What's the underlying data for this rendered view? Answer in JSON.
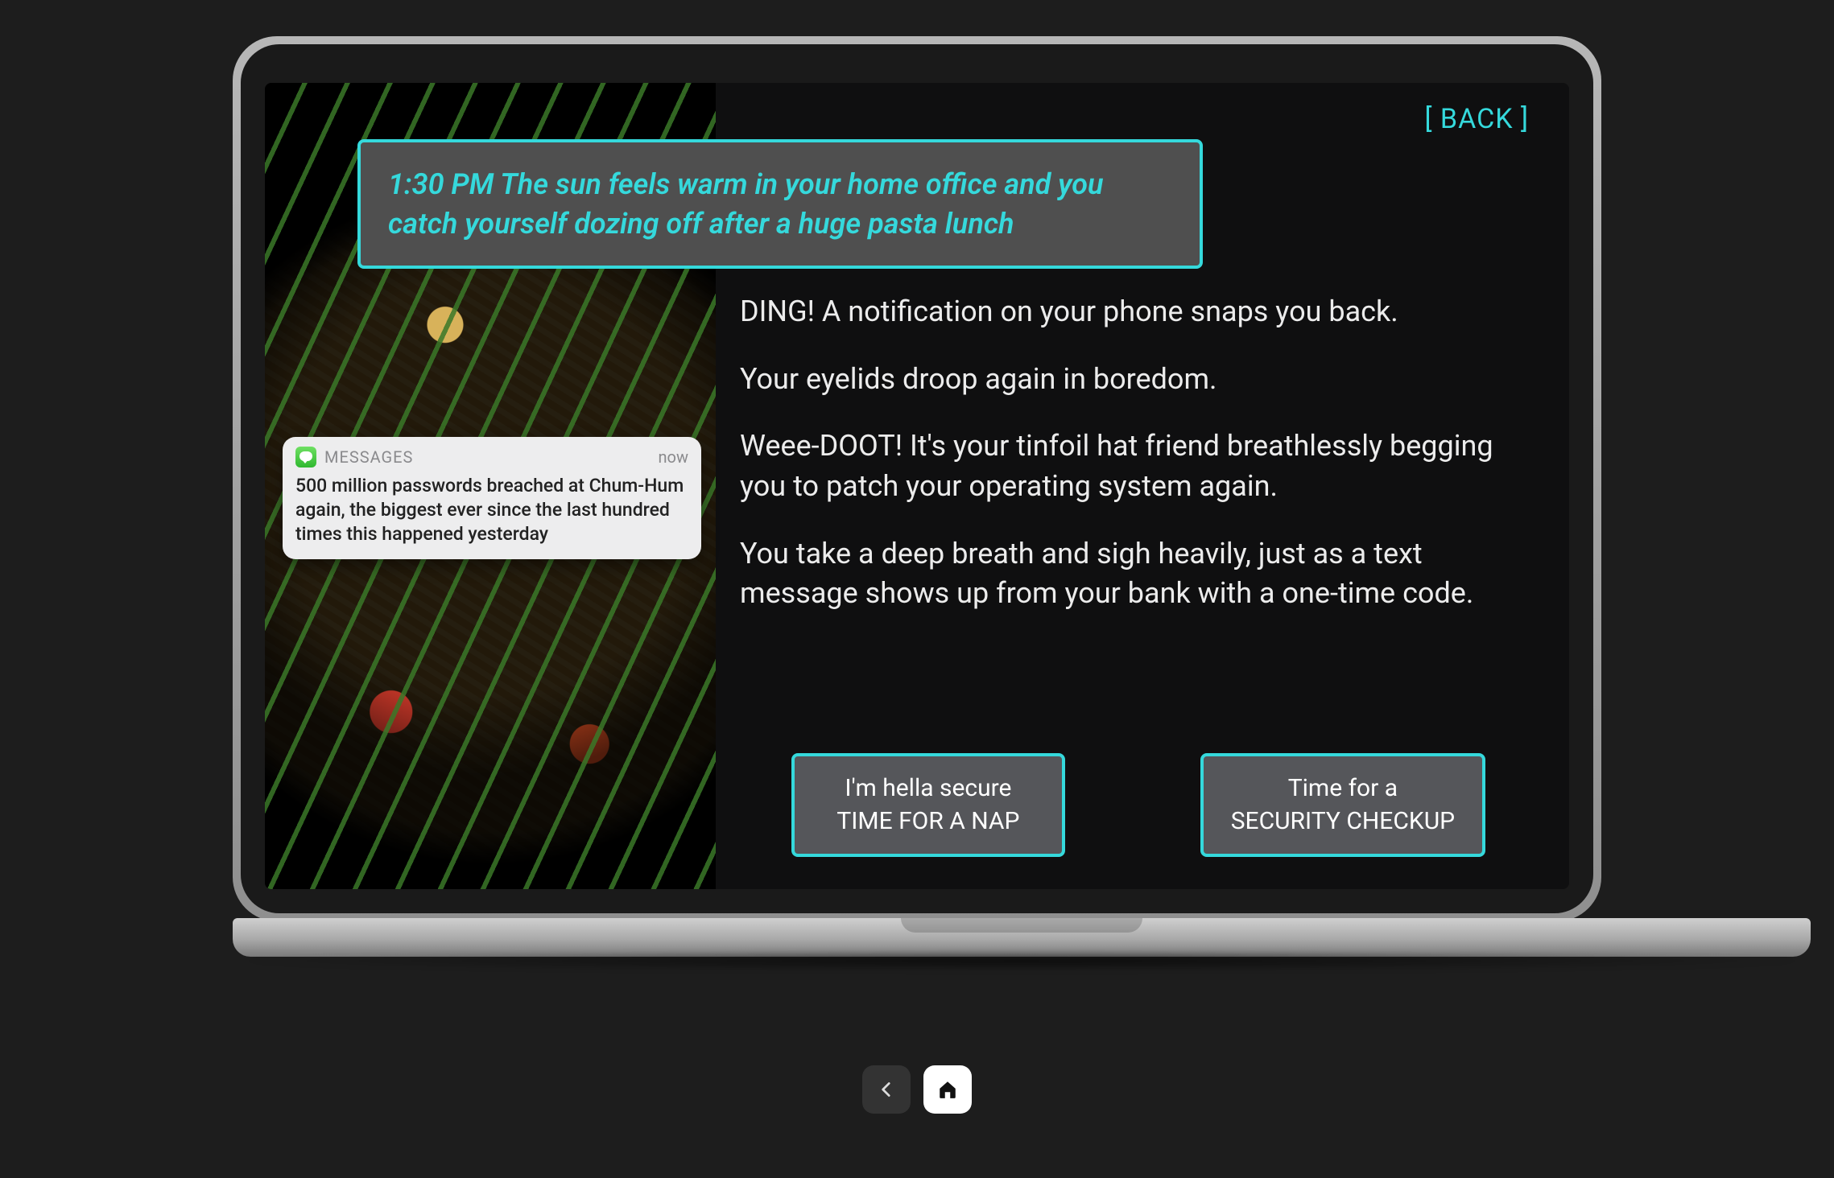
{
  "header": {
    "back_label": "[ BACK ]"
  },
  "headline": "1:30 PM The sun feels warm in your home office and you catch yourself dozing off after a huge pasta lunch",
  "paragraphs": [
    "DING! A notification on your phone snaps you back.",
    "Your eyelids droop again in boredom.",
    "Weee-DOOT! It's your tinfoil hat friend breathlessly begging you to patch your operating system again.",
    "You take a deep breath and sigh heavily, just as a text message shows up from your bank with a one-time code."
  ],
  "choices": [
    {
      "line1": "I'm hella secure",
      "line2": "TIME FOR A NAP"
    },
    {
      "line1": "Time for a",
      "line2": "SECURITY CHECKUP"
    }
  ],
  "notification": {
    "app": "MESSAGES",
    "time": "now",
    "body": "500 million passwords breached at Chum-Hum again, the biggest ever since the last hundred times this happened yesterday"
  },
  "toolbar": {
    "back_icon": "chevron-left-icon",
    "home_icon": "home-icon"
  },
  "colors": {
    "accent": "#35d9dc",
    "panel": "#4f4f4f",
    "screen_bg": "#0f0f10"
  }
}
